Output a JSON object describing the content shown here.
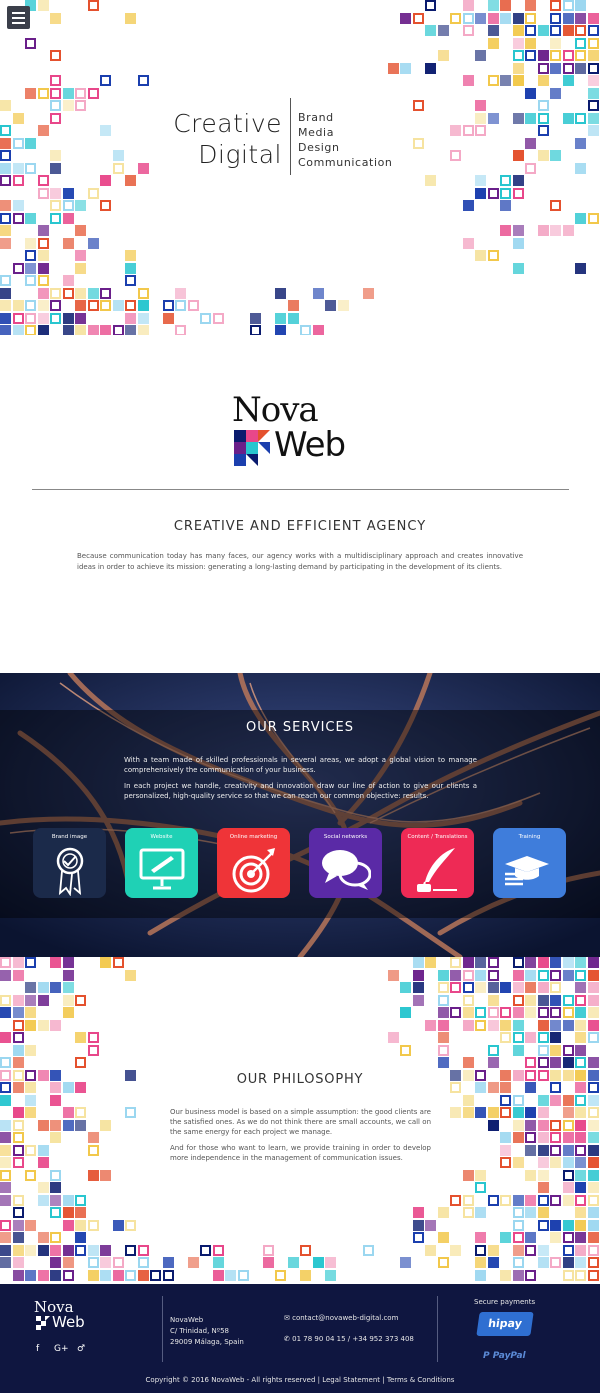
{
  "header": {
    "menu_icon": "hamburger-menu-icon"
  },
  "hero": {
    "title_line1": "Creative",
    "title_line2": "Digital",
    "keywords": [
      "Brand",
      "Media",
      "Design",
      "Communication"
    ]
  },
  "brand": {
    "logo_word1": "Nova",
    "logo_word2": "Web"
  },
  "intro": {
    "title": "CREATIVE AND EFFICIENT AGENCY",
    "text": "Because communication today has many faces, our agency works with a multidisciplinary approach and creates innovative ideas in order to achieve its mission: generating a long-lasting demand by participating in the development of its clients."
  },
  "services": {
    "title": "OUR SERVICES",
    "paragraph1": "With a team made of skilled professionals in several areas, we adopt a global vision to manage comprehensively the communication of your business.",
    "paragraph2": "In each project we handle, creativity and innovation draw our line of action to give our clients a personalized, high-quality service so that we can reach our common objective: results.",
    "tiles": [
      {
        "label": "Brand image",
        "icon": "award-ribbon-icon",
        "color": "#1b2a4a"
      },
      {
        "label": "Website",
        "icon": "monitor-pen-icon",
        "color": "#1fd1b5"
      },
      {
        "label": "Online marketing",
        "icon": "target-dart-icon",
        "color": "#ef3438"
      },
      {
        "label": "Social networks",
        "icon": "chat-bubbles-icon",
        "color": "#5a2aa6"
      },
      {
        "label": "Content / Translations",
        "icon": "quill-ink-icon",
        "color": "#ee2a55"
      },
      {
        "label": "Training",
        "icon": "graduation-cap-icon",
        "color": "#3f7ddb"
      }
    ]
  },
  "philosophy": {
    "title": "OUR PHILOSOPHY",
    "paragraph1": "Our business model is based on a simple assumption: the good clients are the satisfied ones. As we do not think there are small accounts, we call on the same energy for each project we manage.",
    "paragraph2": "And for those who want to learn, we provide training in order to develop more independence in the management of communication issues."
  },
  "footer": {
    "logo_word1": "Nova",
    "logo_word2": "Web",
    "social": [
      "f",
      "G+",
      "♂"
    ],
    "address_name": "NovaWeb",
    "address_street": "C/ Trinidad, Nº58",
    "address_city": "29009 Málaga, Spain",
    "email": "contact@novaweb-digital.com",
    "phone": "01 78 90 04 15 / +34 952 373 408",
    "secure_label": "Secure payments",
    "payment1": "hipay",
    "payment2": "PayPal",
    "copyright": "Copyright © 2016 NovaWeb - All rights reserved |",
    "legal": "Legal Statement",
    "sep": "|",
    "terms": "Terms & Conditions"
  },
  "colors": {
    "pixel_palette": [
      "#1b3fae",
      "#e8478a",
      "#29c6cf",
      "#f2c84b",
      "#e4512e",
      "#6a1f8a",
      "#f4a9c6",
      "#9bd7f0",
      "#f6e3a0",
      "#0a1b6e"
    ],
    "footer_bg": "#0f1640",
    "services_bg": "#111a3a"
  }
}
